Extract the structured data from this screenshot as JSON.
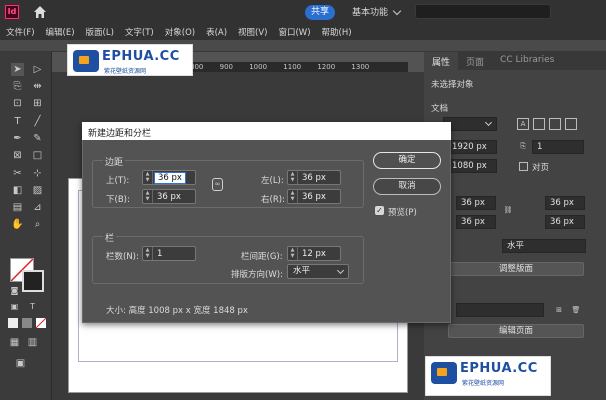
{
  "app": {
    "icon_text": "Id",
    "share_label": "共享",
    "workspace_label": "基本功能"
  },
  "menu": [
    "文件(F)",
    "编辑(E)",
    "版面(L)",
    "文字(T)",
    "对象(O)",
    "表(A)",
    "视图(V)",
    "窗口(W)",
    "帮助(H)"
  ],
  "ruler_ticks": [
    "800",
    "900",
    "1000",
    "1100",
    "1200",
    "1300",
    "1400"
  ],
  "watermark": {
    "name": "EPHUA.CC",
    "sub": "紫花壁纸资源网"
  },
  "right_panel": {
    "tabs": [
      "属性",
      "页面",
      "CC Libraries"
    ],
    "no_selection": "未选择对象",
    "doc_section": "文档",
    "width": "1920 px",
    "height": "1080 px",
    "pages_count": "1",
    "facing_pages": "对页",
    "margin_top": "36 px",
    "margin_bottom": "36 px",
    "margin_left": "36 px",
    "margin_right": "36 px",
    "orientation": "水平",
    "adjust_layout_btn": "调整版面",
    "edit_page_btn": "编辑页面"
  },
  "dialog": {
    "title": "新建边距和分栏",
    "margins_group": "边距",
    "top_label": "上(T):",
    "top_value": "36 px",
    "bottom_label": "下(B):",
    "bottom_value": "36 px",
    "left_label": "左(L):",
    "left_value": "36 px",
    "right_label": "右(R):",
    "right_value": "36 px",
    "columns_group": "栏",
    "columns_label": "栏数(N):",
    "columns_value": "1",
    "gutter_label": "栏间距(G):",
    "gutter_value": "12 px",
    "direction_label": "排版方向(W):",
    "direction_value": "水平",
    "size_text": "大小: 高度 1008 px x 宽度 1848 px",
    "ok_label": "确定",
    "cancel_label": "取消",
    "preview_label": "预览(P)"
  },
  "colors": {
    "accent": "#2a6ed0",
    "app_bg": "#323232",
    "dialog_bg": "#535353"
  }
}
